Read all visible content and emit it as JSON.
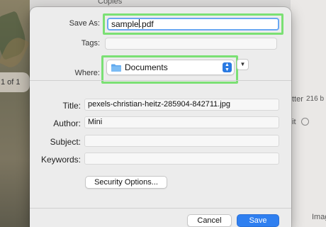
{
  "background": {
    "top_label": "Copies",
    "page_indicator": "1 of 1",
    "right_texts": [
      "tter",
      "216 b",
      "it",
      "Image"
    ]
  },
  "dialog": {
    "save_as": {
      "label": "Save As:",
      "value_before_caret": "sample",
      "value_after_caret": ".pdf"
    },
    "tags": {
      "label": "Tags:",
      "value": ""
    },
    "where": {
      "label": "Where:",
      "value": "Documents",
      "icon": "folder-icon"
    },
    "expand_icon": "chevron-down-icon",
    "title": {
      "label": "Title:",
      "value": "pexels-christian-heitz-285904-842711.jpg"
    },
    "author": {
      "label": "Author:",
      "value": "Mini"
    },
    "subject": {
      "label": "Subject:",
      "value": ""
    },
    "keywords": {
      "label": "Keywords:",
      "value": ""
    },
    "security_button": "Security Options...",
    "cancel_button": "Cancel",
    "save_button": "Save"
  },
  "colors": {
    "highlight": "#7be074",
    "focus_ring": "#6aa8f2",
    "accent": "#2f7ff0"
  }
}
